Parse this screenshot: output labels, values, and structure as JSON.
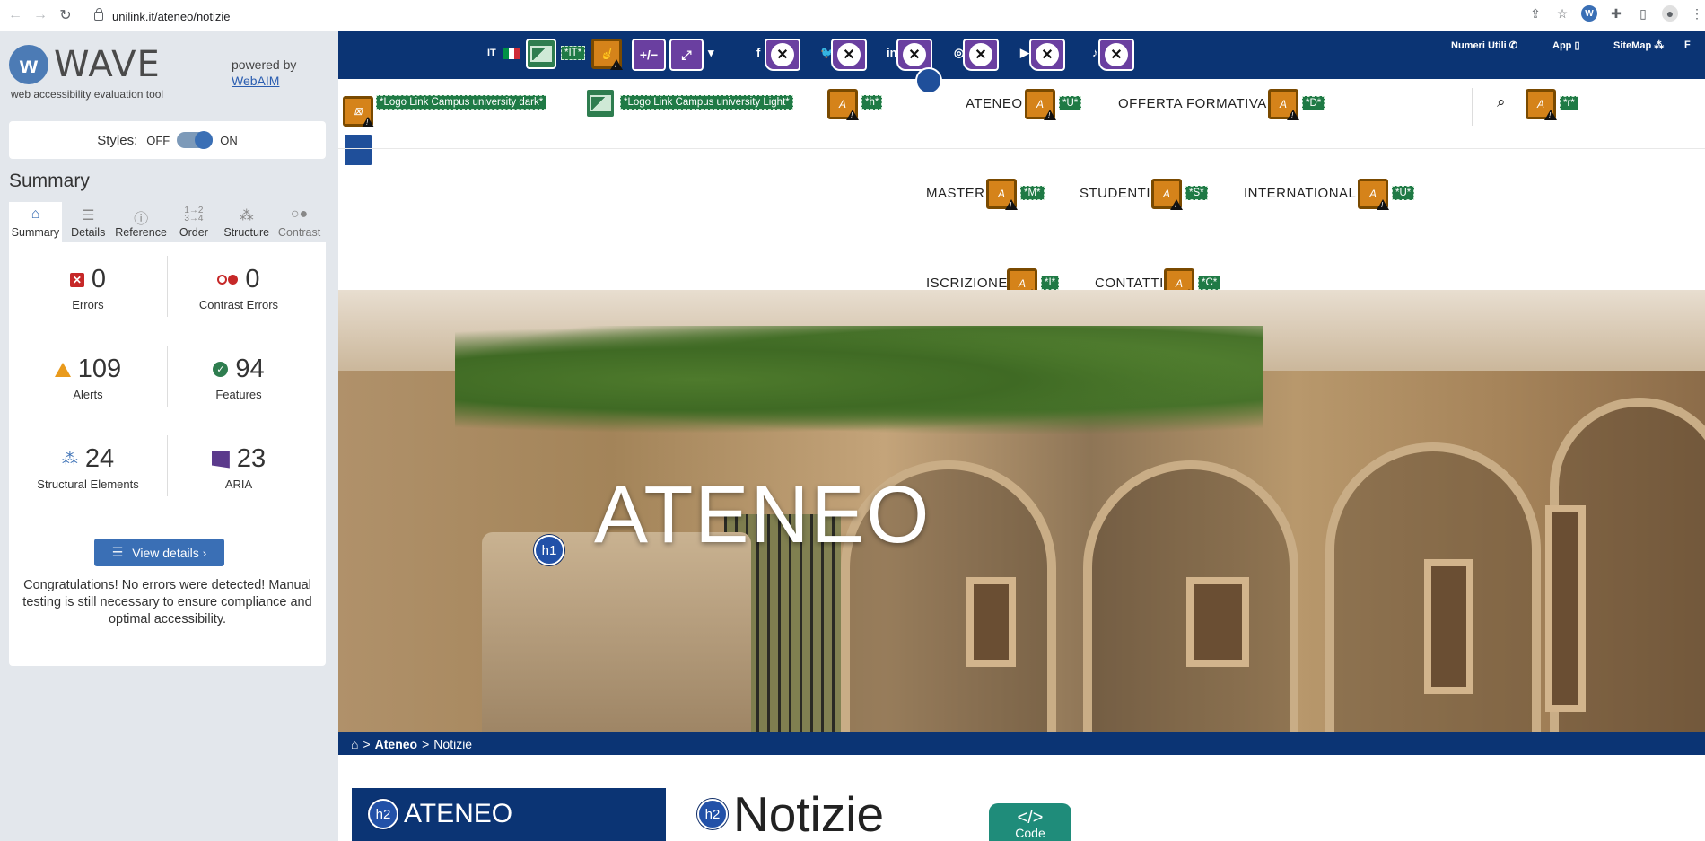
{
  "browser": {
    "url": "unilink.it/ateneo/notizie"
  },
  "wave": {
    "brand": "WAVE",
    "tagline": "web accessibility evaluation tool",
    "powered_by": "powered by",
    "webaim": "WebAIM",
    "styles_label": "Styles:",
    "styles_off": "OFF",
    "styles_on": "ON",
    "summary_title": "Summary",
    "tabs": [
      {
        "label": "Summary",
        "icon": "home-icon"
      },
      {
        "label": "Details",
        "icon": "list-icon"
      },
      {
        "label": "Reference",
        "icon": "info-icon"
      },
      {
        "label": "Order",
        "icon": "order-icon"
      },
      {
        "label": "Structure",
        "icon": "structure-icon"
      },
      {
        "label": "Contrast",
        "icon": "contrast-icon"
      }
    ],
    "stats": {
      "errors": {
        "value": "0",
        "label": "Errors"
      },
      "contrast_errors": {
        "value": "0",
        "label": "Contrast Errors"
      },
      "alerts": {
        "value": "109",
        "label": "Alerts"
      },
      "features": {
        "value": "94",
        "label": "Features"
      },
      "structural": {
        "value": "24",
        "label": "Structural Elements"
      },
      "aria": {
        "value": "23",
        "label": "ARIA"
      }
    },
    "view_details": "View details ›",
    "congrats": "Congratulations! No errors were detected! Manual testing is still necessary to ensure compliance and optimal accessibility.",
    "colors": {
      "accent": "#3a6fb5",
      "error": "#c62828",
      "alert": "#e99a1c",
      "feature": "#2e7d4f",
      "aria": "#5b3a8c"
    }
  },
  "site": {
    "topbar": {
      "lang": "IT",
      "lang_label": "*IT*",
      "aria_plusminus": "+/−",
      "social": [
        "f",
        "t",
        "in",
        "ig",
        "yt",
        "tk"
      ],
      "right_links": [
        "Numeri Utili",
        "App",
        "SiteMap"
      ],
      "last_letter": "F"
    },
    "logo_dark_label": "*Logo Link Campus university dark*",
    "logo_light_label": "*Logo Link Campus university Light*",
    "h_label": "*h*",
    "menu": [
      {
        "label": "ATENEO",
        "key": "*U*"
      },
      {
        "label": "OFFERTA FORMATIVA",
        "key": "*D*"
      },
      {
        "label": "MASTER",
        "key": "*M*"
      },
      {
        "label": "STUDENTI",
        "key": "*S*"
      },
      {
        "label": "INTERNATIONAL",
        "key": "*U*"
      },
      {
        "label": "ISCRIZIONE",
        "key": "*I*"
      },
      {
        "label": "CONTATTI",
        "key": "*C*"
      }
    ],
    "search_key": "*r*",
    "hero_title": "ATENEO",
    "h1_badge": "h1",
    "breadcrumb": {
      "sep": ">",
      "parent": "Ateneo",
      "current": "Notizie"
    },
    "side_heading": "ATENEO",
    "page_heading": "Notizie",
    "h2_badge": "h2",
    "code_badge_symbol": "</>",
    "code_badge_label": "Code",
    "colors": {
      "navy": "#0b3474",
      "wave_green": "#2e7d4f",
      "wave_alert": "#d5831a",
      "wave_aria": "#6a3fa0"
    }
  }
}
